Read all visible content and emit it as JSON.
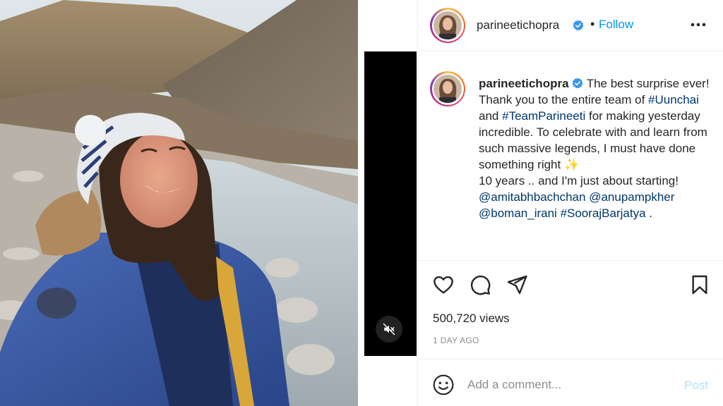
{
  "post": {
    "username": "parineetichopra",
    "follow_label": "Follow",
    "separator": "•",
    "caption": {
      "username": "parineetichopra",
      "line1": "The best surprise ever! Thank you to the entire team of",
      "tag1": "#Uunchai",
      "and": "and",
      "tag2": "#TeamParineeti",
      "line2": "for making yesterday incredible. To celebrate with and learn from such massive legends, I must have done something right",
      "sparkle": "✨",
      "line3": "10 years .. and I'm just about starting!",
      "mention1": "@amitabhbachchan",
      "mention2": "@anupampkher",
      "mention3": "@boman_irani",
      "tag3": "#SoorajBarjatya",
      "ending": "."
    },
    "views": "500,720 views",
    "time_ago": "1 DAY AGO",
    "comment_placeholder": "Add a comment...",
    "post_label": "Post"
  },
  "icons": {
    "verified": "verified-badge-icon",
    "more": "more-options-icon",
    "like": "heart-icon",
    "comment": "comment-icon",
    "share": "paper-plane-icon",
    "save": "bookmark-icon",
    "emoji": "smiley-icon",
    "mute": "speaker-muted-icon"
  },
  "colors": {
    "link": "#00376b",
    "follow": "#0095f6",
    "post_disabled": "#b2dffc",
    "muted_text": "#8e8e8e"
  }
}
